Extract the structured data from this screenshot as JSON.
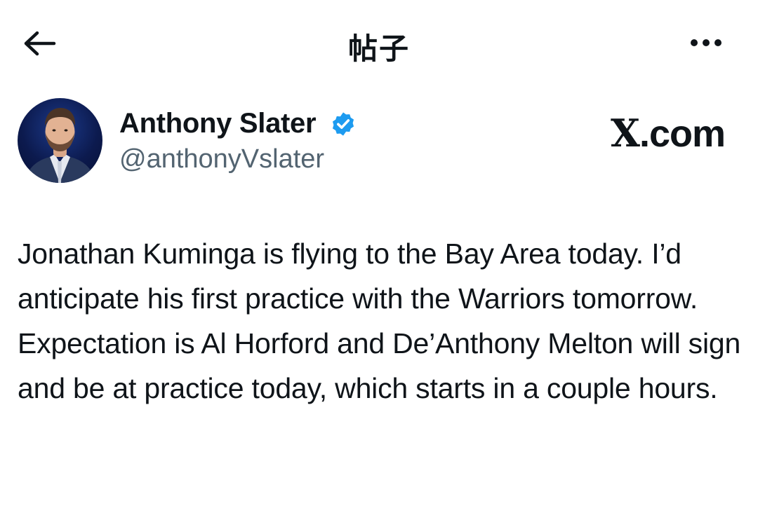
{
  "header": {
    "title": "帖子",
    "back_icon": "arrow-left-icon",
    "more_icon": "more-horizontal-icon"
  },
  "author": {
    "name": "Anthony Slater",
    "handle": "@anthonyVslater",
    "verified_color": "#1d9bf0"
  },
  "brand": {
    "x": "X",
    "suffix": ".com"
  },
  "tweet": {
    "text": "Jonathan Kuminga is flying to the Bay Area today. I’d anticipate his first practice with the Warriors tomorrow. Expectation is Al Horford and De’Anthony Melton will sign and be at practice today, which starts in a couple hours."
  }
}
